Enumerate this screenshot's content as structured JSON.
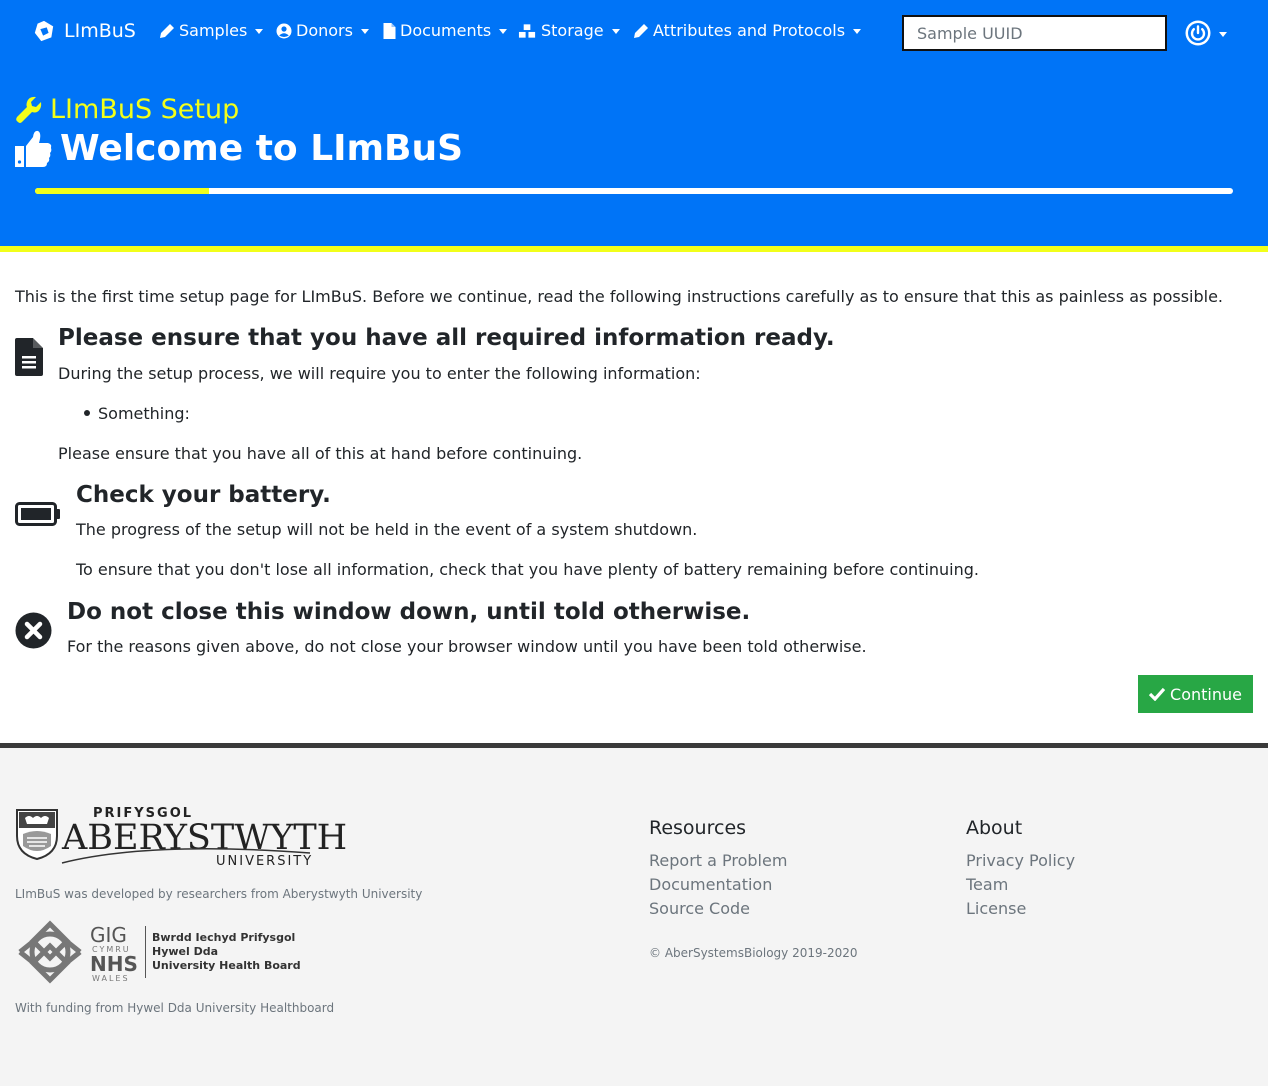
{
  "nav": {
    "brand": "LImBuS",
    "items": [
      {
        "label": "Samples",
        "icon": "pen-icon"
      },
      {
        "label": "Donors",
        "icon": "user-circle-icon"
      },
      {
        "label": "Documents",
        "icon": "file-icon"
      },
      {
        "label": "Storage",
        "icon": "boxes-icon"
      },
      {
        "label": "Attributes and Protocols",
        "icon": "pen-icon"
      }
    ],
    "search_placeholder": "Sample UUID",
    "power_icon": "power-icon"
  },
  "hero": {
    "subtitle": "LImBuS Setup",
    "title": "Welcome to LImBuS",
    "progress_fraction": 0.145
  },
  "intro": "This is the first time setup page for LImBuS. Before we continue, read the following instructions carefully as to ensure that this as painless as possible.",
  "sections": {
    "info": {
      "title": "Please ensure that you have all required information ready.",
      "text1": "During the setup process, we will require you to enter the following information:",
      "bullet": "Something:",
      "text2": "Please ensure that you have all of this at hand before continuing."
    },
    "battery": {
      "title": "Check your battery.",
      "text1": "The progress of the setup will not be held in the event of a system shutdown.",
      "text2": "To ensure that you don't lose all information, check that you have plenty of battery remaining before continuing."
    },
    "window": {
      "title": "Do not close this window down, until told otherwise.",
      "text1": "For the reasons given above, do not close your browser window until you have been told otherwise."
    }
  },
  "continue_label": "Continue",
  "footer": {
    "aber": {
      "line1": "PRIFYSGOL",
      "line2": "ABERYSTWYTH",
      "line3": "UNIVERSITY"
    },
    "developed_by": "LImBuS was developed by researchers from Aberystwyth University",
    "nhs": {
      "gig": "GIG",
      "cymru": "CYMRU",
      "nhs": "NHS",
      "wales": "WALES",
      "board1": "Bwrdd Iechyd Prifysgol",
      "board2": "Hywel Dda",
      "board3": "University Health Board"
    },
    "funding": "With funding from Hywel Dda University Healthboard",
    "resources": {
      "heading": "Resources",
      "links": [
        "Report a Problem",
        "Documentation",
        "Source Code"
      ]
    },
    "about": {
      "heading": "About",
      "links": [
        "Privacy Policy",
        "Team",
        "License"
      ]
    },
    "copyright": "© AberSystemsBiology 2019-2020"
  },
  "colors": {
    "primary": "#0074f7",
    "accent": "#f2ff1a",
    "success": "#28a745",
    "footer_bg": "#f4f4f4"
  }
}
